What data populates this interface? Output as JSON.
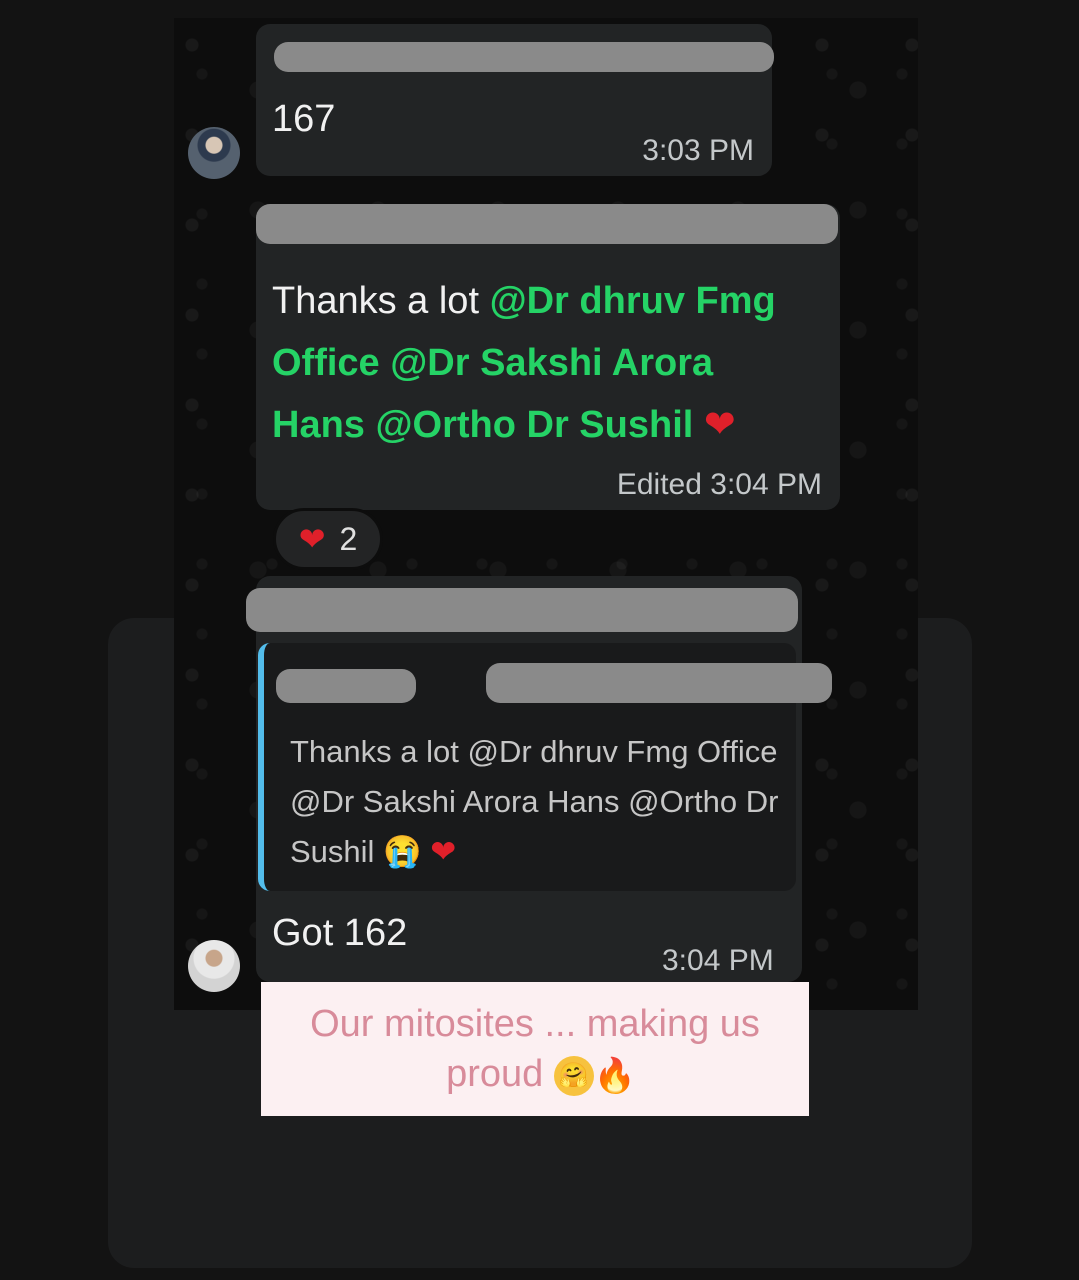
{
  "messages": [
    {
      "body": "167",
      "time": "3:03 PM"
    },
    {
      "body_plain": "Thanks a lot ",
      "mentions": [
        "@Dr dhruv Fmg",
        "Office  @Dr Sakshi Arora",
        "Hans @Ortho Dr Sushil"
      ],
      "reaction_emoji": "❤",
      "edited_label": "Edited",
      "time": "3:04 PM",
      "reaction_count": "2"
    },
    {
      "quoted_text": "Thanks a lot @Dr dhruv Fmg Office  @Dr Sakshi Arora Hans @Ortho Dr Sushil",
      "quoted_emojis": [
        "😭",
        "❤"
      ],
      "body": "Got 162",
      "time": "3:04 PM"
    }
  ],
  "reaction": {
    "emoji": "❤",
    "count": "2"
  },
  "story_caption": {
    "text": "Our mitosites ... making us proud",
    "emojis": [
      "🤗",
      "🔥"
    ]
  },
  "colors": {
    "mention": "#25d366",
    "quote_bar": "#53bdeb",
    "bubble": "#222425",
    "caption_bg": "#fcf0f2",
    "caption_text": "#d88b9a"
  }
}
